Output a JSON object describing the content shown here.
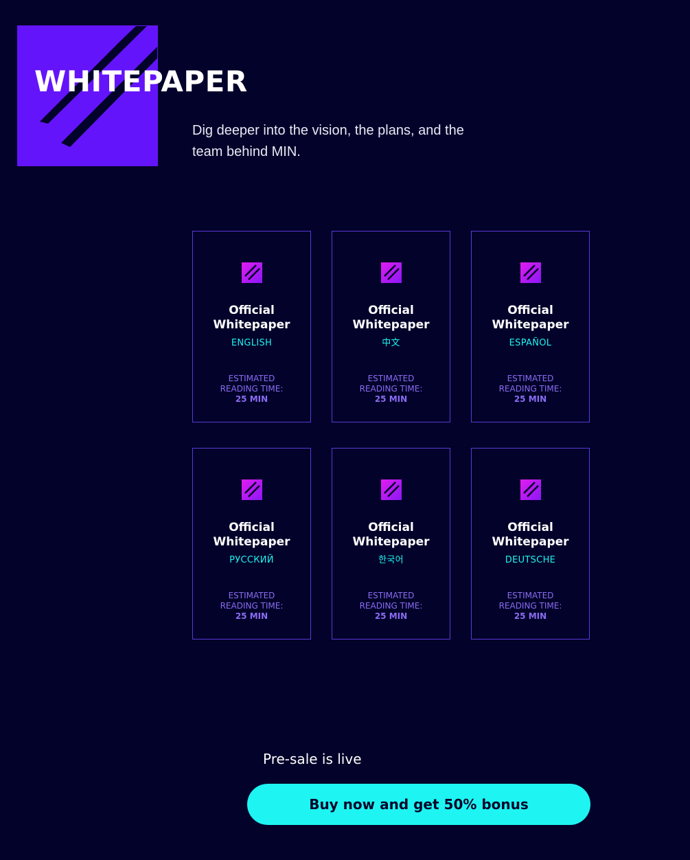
{
  "header": {
    "title": "WHITEPAPER",
    "subtitle": "Dig deeper into the vision, the plans, and the team behind MIN.",
    "accent_color": "#6414fa"
  },
  "cards": [
    {
      "title": "Official Whitepaper",
      "language": "ENGLISH",
      "estimate_label": "ESTIMATED READING TIME:",
      "time": "25 MIN",
      "icon": "document-stripes-icon"
    },
    {
      "title": "Official Whitepaper",
      "language": "中文",
      "estimate_label": "ESTIMATED READING TIME:",
      "time": "25 MIN",
      "icon": "document-stripes-icon"
    },
    {
      "title": "Official Whitepaper",
      "language": "ESPAÑOL",
      "estimate_label": "ESTIMATED READING TIME:",
      "time": "25 MIN",
      "icon": "document-stripes-icon"
    },
    {
      "title": "Official Whitepaper",
      "language": "РУССКИЙ",
      "estimate_label": "ESTIMATED READING TIME:",
      "time": "25 MIN",
      "icon": "document-stripes-icon"
    },
    {
      "title": "Official Whitepaper",
      "language": "한국어",
      "estimate_label": "ESTIMATED READING TIME:",
      "time": "25 MIN",
      "icon": "document-stripes-icon"
    },
    {
      "title": "Official Whitepaper",
      "language": "DEUTSCHE",
      "estimate_label": "ESTIMATED READING TIME:",
      "time": "25 MIN",
      "icon": "document-stripes-icon"
    }
  ],
  "presale": {
    "status_text": "Pre-sale is live",
    "button_label": "Buy now and get 50% bonus",
    "button_color": "#1ef5f2"
  },
  "colors": {
    "background": "#02022a",
    "card_border": "#5a3bd6",
    "language_text": "#1ff2ee",
    "muted_text": "#8a6cf2",
    "icon_gradient_start": "#e21cf0",
    "icon_gradient_end": "#8a18f5"
  }
}
